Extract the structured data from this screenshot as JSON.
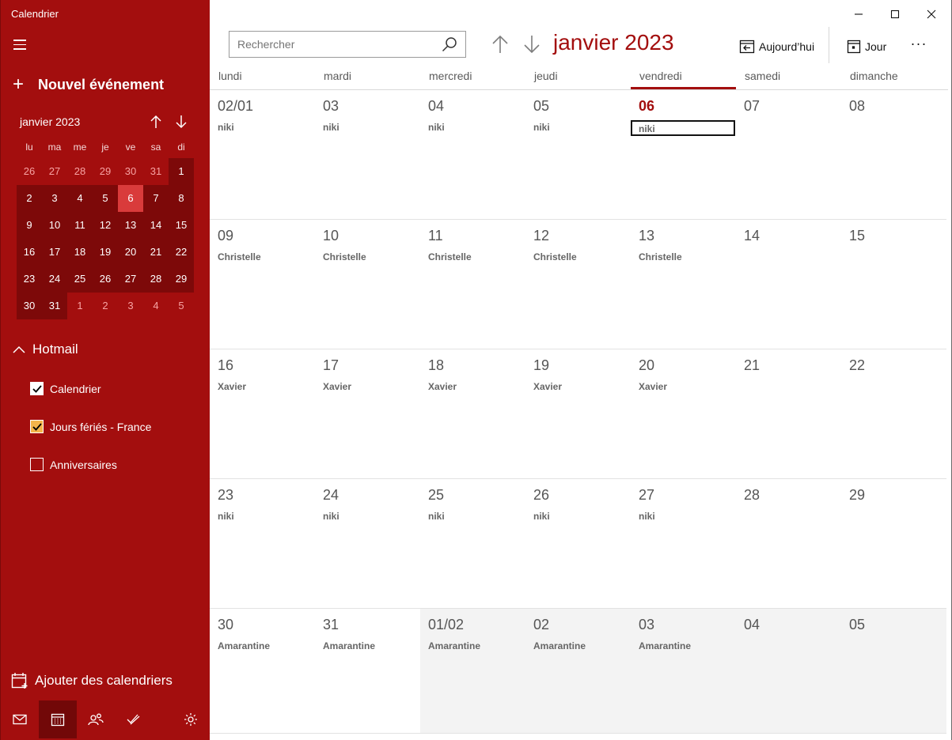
{
  "app": {
    "title": "Calendrier"
  },
  "sidebar": {
    "new_event": "Nouvel événement",
    "mini_calendar": {
      "title": "janvier 2023",
      "weekdays": [
        "lu",
        "ma",
        "me",
        "je",
        "ve",
        "sa",
        "di"
      ],
      "days": [
        {
          "d": "26",
          "type": "other"
        },
        {
          "d": "27",
          "type": "other"
        },
        {
          "d": "28",
          "type": "other"
        },
        {
          "d": "29",
          "type": "other"
        },
        {
          "d": "30",
          "type": "other"
        },
        {
          "d": "31",
          "type": "other"
        },
        {
          "d": "1",
          "type": "cur"
        },
        {
          "d": "2",
          "type": "cur"
        },
        {
          "d": "3",
          "type": "cur"
        },
        {
          "d": "4",
          "type": "cur"
        },
        {
          "d": "5",
          "type": "cur"
        },
        {
          "d": "6",
          "type": "today"
        },
        {
          "d": "7",
          "type": "cur"
        },
        {
          "d": "8",
          "type": "cur"
        },
        {
          "d": "9",
          "type": "cur"
        },
        {
          "d": "10",
          "type": "cur"
        },
        {
          "d": "11",
          "type": "cur"
        },
        {
          "d": "12",
          "type": "cur"
        },
        {
          "d": "13",
          "type": "cur"
        },
        {
          "d": "14",
          "type": "cur"
        },
        {
          "d": "15",
          "type": "cur"
        },
        {
          "d": "16",
          "type": "cur"
        },
        {
          "d": "17",
          "type": "cur"
        },
        {
          "d": "18",
          "type": "cur"
        },
        {
          "d": "19",
          "type": "cur"
        },
        {
          "d": "20",
          "type": "cur"
        },
        {
          "d": "21",
          "type": "cur"
        },
        {
          "d": "22",
          "type": "cur"
        },
        {
          "d": "23",
          "type": "cur"
        },
        {
          "d": "24",
          "type": "cur"
        },
        {
          "d": "25",
          "type": "cur"
        },
        {
          "d": "26",
          "type": "cur"
        },
        {
          "d": "27",
          "type": "cur"
        },
        {
          "d": "28",
          "type": "cur"
        },
        {
          "d": "29",
          "type": "cur"
        },
        {
          "d": "30",
          "type": "cur"
        },
        {
          "d": "31",
          "type": "cur"
        },
        {
          "d": "1",
          "type": "other"
        },
        {
          "d": "2",
          "type": "other"
        },
        {
          "d": "3",
          "type": "other"
        },
        {
          "d": "4",
          "type": "other"
        },
        {
          "d": "5",
          "type": "other"
        }
      ]
    },
    "account": "Hotmail",
    "calendars": [
      {
        "label": "Calendrier",
        "checked": true,
        "color": "#ffffff"
      },
      {
        "label": "Jours fériés - France",
        "checked": true,
        "color": "#f4b44b"
      },
      {
        "label": "Anniversaires",
        "checked": false,
        "color": ""
      }
    ],
    "add_calendars": "Ajouter des calendriers",
    "bottom_nav": [
      "mail-icon",
      "calendar-icon",
      "people-icon",
      "todo-icon",
      "settings-icon"
    ]
  },
  "toolbar": {
    "search_placeholder": "Rechercher",
    "month_title": "janvier 2023",
    "today_label": "Aujourd’hui",
    "view_label": "Jour",
    "more_label": "···"
  },
  "month_view": {
    "weekdays": [
      "lundi",
      "mardi",
      "mercredi",
      "jeudi",
      "vendredi",
      "samedi",
      "dimanche"
    ],
    "selected_weekday": 4,
    "weeks": [
      [
        {
          "d": "02/01",
          "ev": "niki"
        },
        {
          "d": "03",
          "ev": "niki"
        },
        {
          "d": "04",
          "ev": "niki"
        },
        {
          "d": "05",
          "ev": "niki"
        },
        {
          "d": "06",
          "ev": "niki",
          "today": true
        },
        {
          "d": "07",
          "ev": ""
        },
        {
          "d": "08",
          "ev": ""
        }
      ],
      [
        {
          "d": "09",
          "ev": "Christelle"
        },
        {
          "d": "10",
          "ev": "Christelle"
        },
        {
          "d": "11",
          "ev": "Christelle"
        },
        {
          "d": "12",
          "ev": "Christelle"
        },
        {
          "d": "13",
          "ev": "Christelle"
        },
        {
          "d": "14",
          "ev": ""
        },
        {
          "d": "15",
          "ev": ""
        }
      ],
      [
        {
          "d": "16",
          "ev": "Xavier"
        },
        {
          "d": "17",
          "ev": "Xavier"
        },
        {
          "d": "18",
          "ev": "Xavier"
        },
        {
          "d": "19",
          "ev": "Xavier"
        },
        {
          "d": "20",
          "ev": "Xavier"
        },
        {
          "d": "21",
          "ev": ""
        },
        {
          "d": "22",
          "ev": ""
        }
      ],
      [
        {
          "d": "23",
          "ev": "niki"
        },
        {
          "d": "24",
          "ev": "niki"
        },
        {
          "d": "25",
          "ev": "niki"
        },
        {
          "d": "26",
          "ev": "niki"
        },
        {
          "d": "27",
          "ev": "niki"
        },
        {
          "d": "28",
          "ev": ""
        },
        {
          "d": "29",
          "ev": ""
        }
      ],
      [
        {
          "d": "30",
          "ev": "Amarantine"
        },
        {
          "d": "31",
          "ev": "Amarantine"
        },
        {
          "d": "01/02",
          "ev": "Amarantine",
          "outside": true
        },
        {
          "d": "02",
          "ev": "Amarantine",
          "outside": true
        },
        {
          "d": "03",
          "ev": "Amarantine",
          "outside": true
        },
        {
          "d": "04",
          "ev": "",
          "outside": true
        },
        {
          "d": "05",
          "ev": "",
          "outside": true
        }
      ]
    ]
  },
  "colors": {
    "accent": "#a30e0e",
    "sidebar": "#a30e0e",
    "mini_month": "#7d0909",
    "mini_today": "#d93b3b"
  }
}
